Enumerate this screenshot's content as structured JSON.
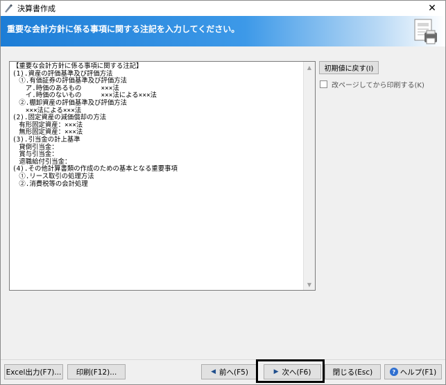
{
  "window": {
    "title": "決算書作成",
    "close_glyph": "✕"
  },
  "header": {
    "instruction": "重要な会計方針に係る事項に関する注記を入力してください。"
  },
  "editor": {
    "content": "【重要な会計方針に係る事項に関する注記】\n(1).資産の評価基準及び評価方法\n　①.有価証券の評価基準及び評価方法\n　　ア.時価のあるもの　　　×××法\n　　イ.時価のないもの　　　×××法による×××法\n　②.棚卸資産の評価基準及び評価方法\n　　×××法による×××法\n(2).固定資産の減価償却の方法\n　有形固定資産：×××法\n　無形固定資産：×××法\n(3).引当金の計上基準\n　貸倒引当金：\n　賞与引当金：\n　退職給付引当金：\n(4).その他計算書類の作成のための基本となる重要事項\n　①.リース取引の処理方法\n　②.消費税等の会計処理",
    "scroll_up": "▲",
    "scroll_down": "▼"
  },
  "side": {
    "reset_label": "初期値に戻す(I)",
    "page_break_label": "改ページしてから印刷する(K)"
  },
  "footer": {
    "excel_label": "Excel出力(F7)...",
    "print_label": "印刷(F12)...",
    "prev_label": "前へ(F5)",
    "next_label": "次へ(F6)",
    "close_label": "閉じる(Esc)",
    "help_label": "ヘルプ(F1)",
    "help_glyph": "?",
    "prev_glyph": "◀",
    "next_glyph": "▶"
  },
  "colors": {
    "header_blue": "#1d7dd6",
    "highlight_border": "#000000"
  }
}
